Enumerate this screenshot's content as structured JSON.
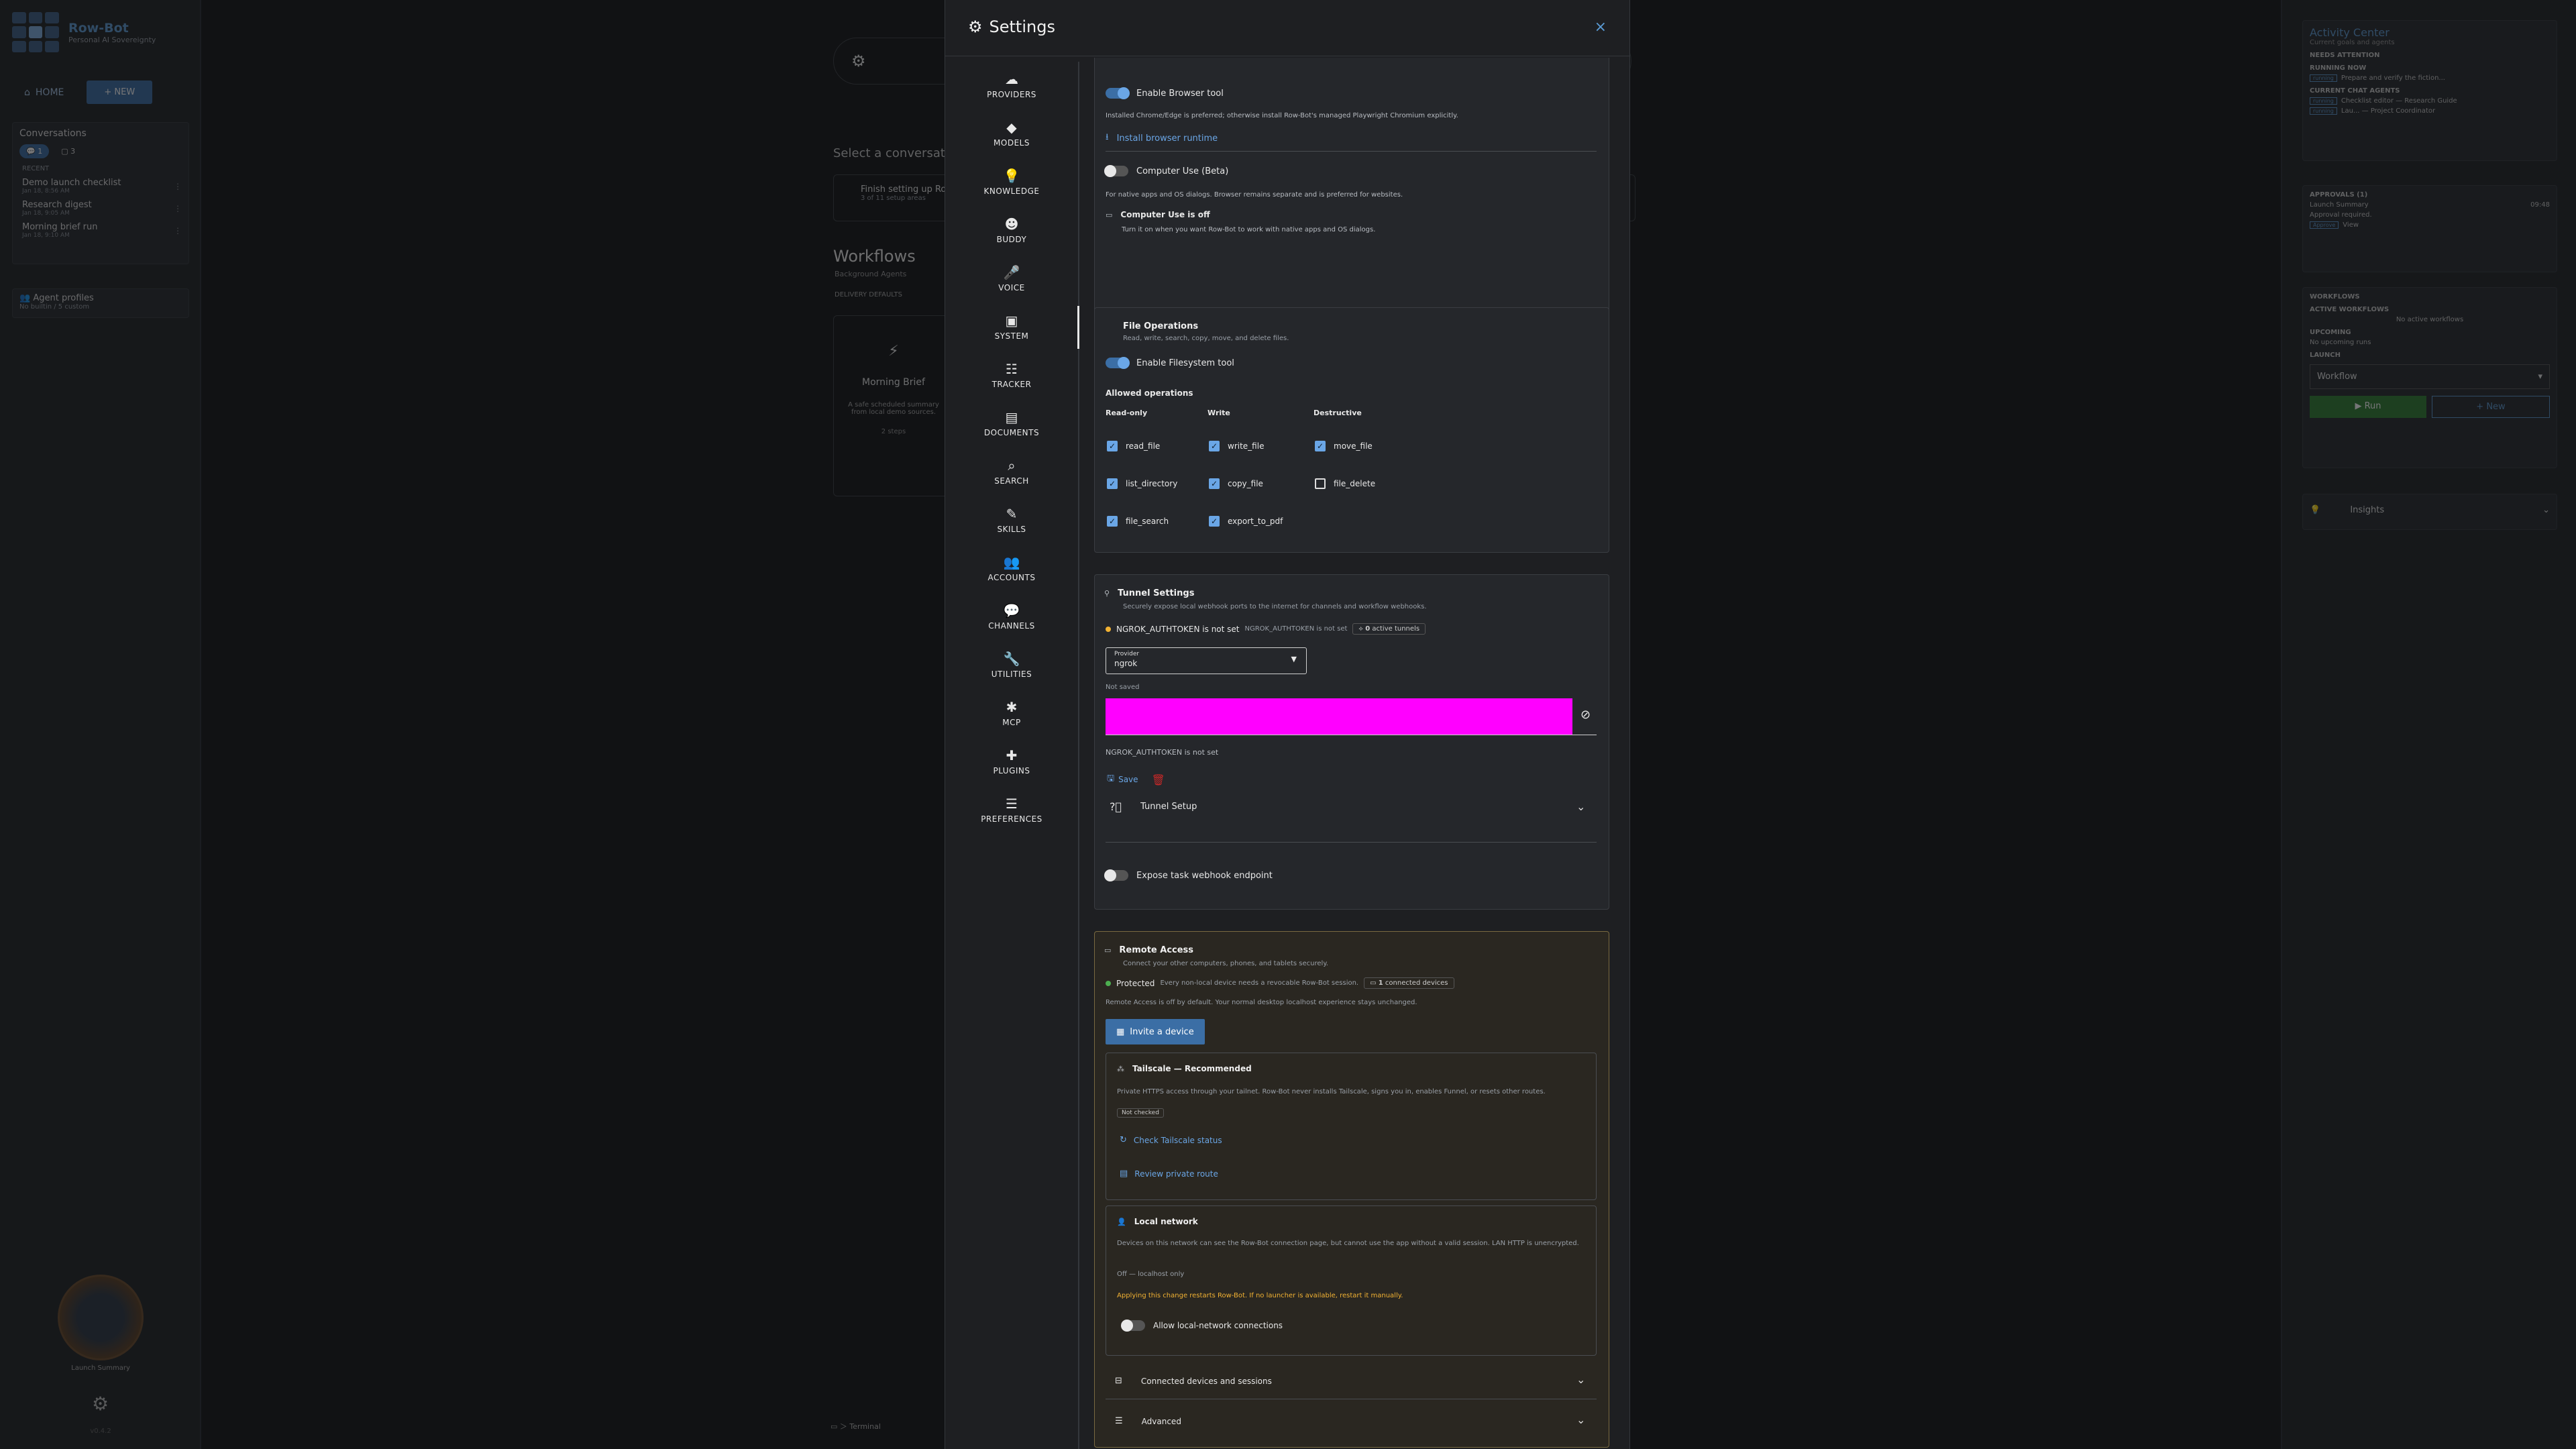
{
  "bg": {
    "brand": {
      "name": "Row-Bot",
      "subtitle": "Personal AI Sovereignty"
    },
    "nav": {
      "home": "HOME",
      "new": "+ NEW"
    },
    "conversations": {
      "title": "Conversations",
      "chip_active": "1",
      "chip_other": "3",
      "recent_label": "RECENT",
      "items": [
        {
          "title": "Demo launch checklist",
          "date": "Jan 18, 8:56 AM"
        },
        {
          "title": "Research digest",
          "date": "Jan 18, 9:05 AM"
        },
        {
          "title": "Morning brief run",
          "date": "Jan 18, 9:10 AM"
        }
      ]
    },
    "agent_profiles": {
      "title": "Agent profiles",
      "sub": "No builtin / 5 custom"
    },
    "avatar_label": "Launch Summary",
    "version": "v0.4.2",
    "center": {
      "select_conversation": "Select a conversation",
      "setup_title": "Finish setting up Row-Bot",
      "setup_sub": "3 of 11 setup areas",
      "workflows_title": "Workflows",
      "workflows_sub": "Background Agents",
      "delivery_defaults": "DELIVERY DEFAULTS",
      "card_title": "Morning Brief",
      "card_desc": "A safe scheduled summary from local demo sources.",
      "card_steps": "2 steps",
      "terminal": "Terminal"
    },
    "activity": {
      "title": "Activity Center",
      "sub": "Current goals and agents",
      "needs_attention": "NEEDS ATTENTION",
      "running_now": "RUNNING NOW",
      "running_item": "Prepare and verify the fiction...",
      "current_agents": "CURRENT CHAT AGENTS",
      "agent1": "Checklist editor",
      "agent1_role": "Research Guide",
      "agent2": "Lau...",
      "agent2_role": "Project Coordinator",
      "tag": "running",
      "approvals": "APPROVALS (1)",
      "approval_item": "Launch Summary",
      "approval_time": "09:48",
      "approval_sub": "Approval required.",
      "approve": "Approve",
      "view": "View",
      "workflows": "WORKFLOWS",
      "active_workflows": "ACTIVE WORKFLOWS",
      "no_active": "No active workflows",
      "upcoming": "UPCOMING",
      "upcoming_sub": "No upcoming runs",
      "launch": "LAUNCH",
      "workflow_select": "Workflow",
      "run": "Run",
      "new": "New",
      "insights": "Insights"
    }
  },
  "modal": {
    "title": "Settings",
    "close": "×",
    "nav": [
      {
        "icon": "☁",
        "label": "PROVIDERS"
      },
      {
        "icon": "◆",
        "label": "MODELS"
      },
      {
        "icon": "💡",
        "label": "KNOWLEDGE"
      },
      {
        "icon": "☻",
        "label": "BUDDY"
      },
      {
        "icon": "🎤",
        "label": "VOICE"
      },
      {
        "icon": "▣",
        "label": "SYSTEM"
      },
      {
        "icon": "☷",
        "label": "TRACKER"
      },
      {
        "icon": "▤",
        "label": "DOCUMENTS"
      },
      {
        "icon": "⌕",
        "label": "SEARCH"
      },
      {
        "icon": "✎",
        "label": "SKILLS"
      },
      {
        "icon": "👥",
        "label": "ACCOUNTS"
      },
      {
        "icon": "💬",
        "label": "CHANNELS"
      },
      {
        "icon": "🔧",
        "label": "UTILITIES"
      },
      {
        "icon": "✱",
        "label": "MCP"
      },
      {
        "icon": "✚",
        "label": "PLUGINS"
      },
      {
        "icon": "☰",
        "label": "PREFERENCES"
      }
    ]
  },
  "browser": {
    "enable_label": "Enable Browser tool",
    "hint": "Installed Chrome/Edge is preferred; otherwise install Row-Bot's managed Playwright Chromium explicitly.",
    "install_link": "Install browser runtime",
    "computer_use_label": "Computer Use (Beta)",
    "computer_use_hint": "For native apps and OS dialogs. Browser remains separate and is preferred for websites.",
    "status_title": "Computer Use is off",
    "status_sub": "Turn it on when you want Row-Bot to work with native apps and OS dialogs."
  },
  "file_ops": {
    "title": "File Operations",
    "sub": "Read, write, search, copy, move, and delete files.",
    "enable_label": "Enable Filesystem tool",
    "allowed": "Allowed operations",
    "col_read": "Read-only",
    "col_write": "Write",
    "col_destructive": "Destructive",
    "ops": {
      "read_file": "read_file",
      "list_directory": "list_directory",
      "file_search": "file_search",
      "write_file": "write_file",
      "copy_file": "copy_file",
      "export_to_pdf": "export_to_pdf",
      "move_file": "move_file",
      "file_delete": "file_delete"
    }
  },
  "tunnel": {
    "title": "Tunnel Settings",
    "sub": "Securely expose local webhook ports to the internet for channels and workflow webhooks.",
    "status": "NGROK_AUTHTOKEN is not set",
    "status_small": "NGROK_AUTHTOKEN is not set",
    "active_count": "0",
    "active_label": "active tunnels",
    "provider_label": "Provider",
    "provider_value": "ngrok",
    "not_saved": "Not saved",
    "token_hint": "NGROK_AUTHTOKEN is not set",
    "save": "Save",
    "setup": "Tunnel Setup",
    "expose": "Expose task webhook endpoint"
  },
  "remote": {
    "title": "Remote Access",
    "sub": "Connect your other computers, phones, and tablets securely.",
    "protected": "Protected",
    "protected_desc": "Every non-local device needs a revocable Row-Bot session.",
    "devices_count": "1",
    "devices_label": "connected devices",
    "off_note": "Remote Access is off by default. Your normal desktop localhost experience stays unchanged.",
    "invite": "Invite a device",
    "tailscale": {
      "title": "Tailscale — Recommended",
      "desc": "Private HTTPS access through your tailnet. Row-Bot never installs Tailscale, signs you in, enables Funnel, or resets other routes.",
      "badge": "Not checked",
      "check": "Check Tailscale status",
      "review": "Review private route"
    },
    "local": {
      "title": "Local network",
      "desc": "Devices on this network can see the Row-Bot connection page, but cannot use the app without a valid session. LAN HTTP is unencrypted.",
      "state": "Off — localhost only",
      "warning": "Applying this change restarts Row-Bot. If no launcher is available, restart it manually.",
      "allow": "Allow local-network connections"
    },
    "connected": "Connected devices and sessions",
    "advanced": "Advanced"
  },
  "colors": {
    "accent": "#6aa6e6",
    "primary": "#3b6ea5",
    "masked": "#ff00ff",
    "warning": "#f2b233",
    "success": "#4caf50",
    "danger": "#c62828"
  }
}
